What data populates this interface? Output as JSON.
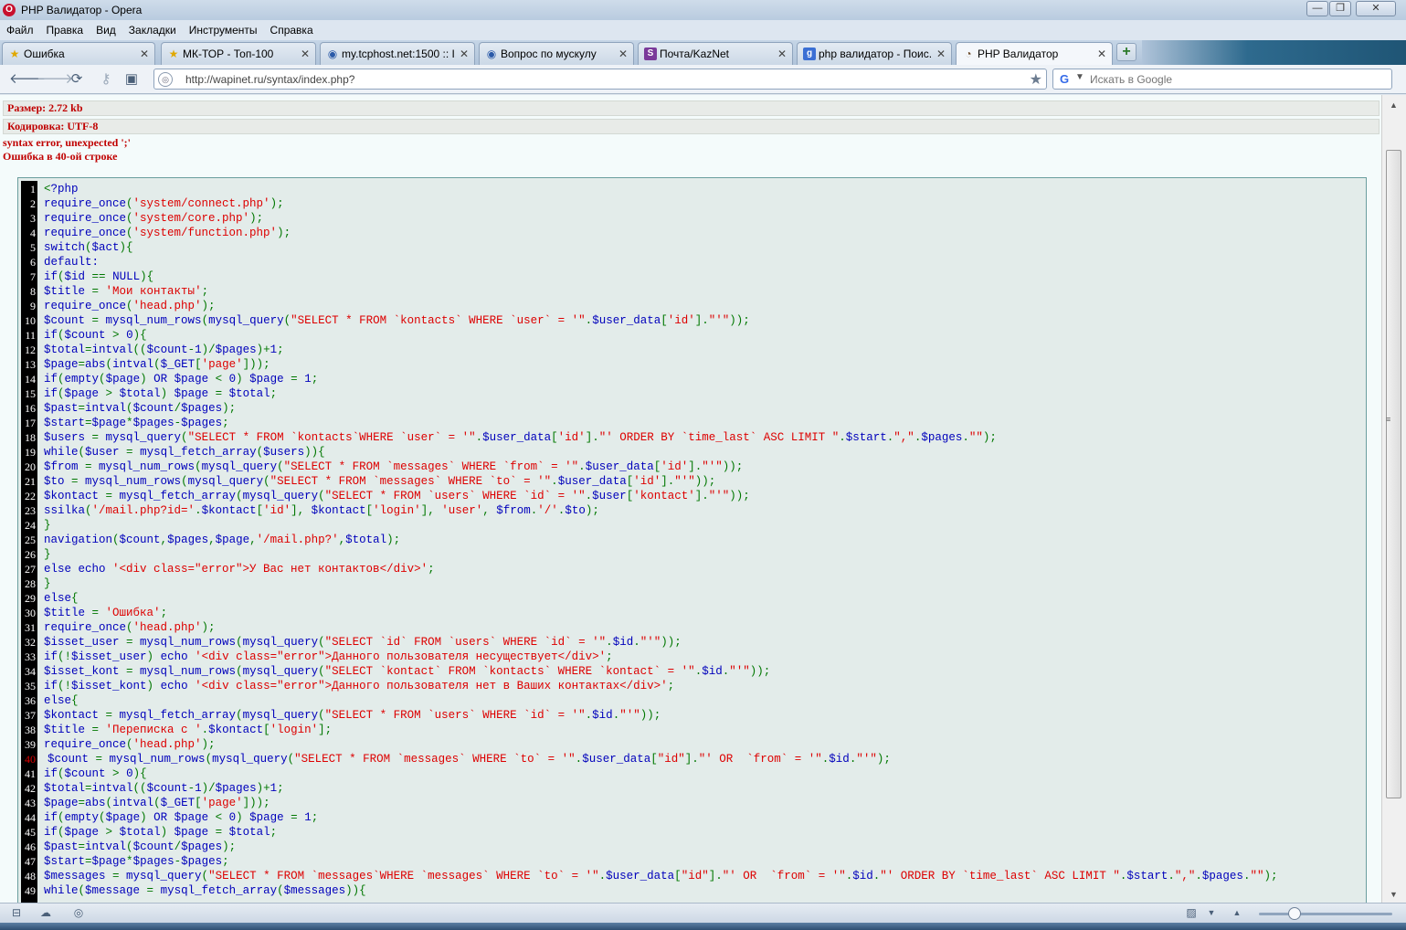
{
  "window": {
    "title": "PHP Валидатор - Opera",
    "logo_letter": "O",
    "controls": {
      "minimize": "—",
      "maximize": "❐",
      "close": "✕"
    }
  },
  "menu": [
    "Файл",
    "Правка",
    "Вид",
    "Закладки",
    "Инструменты",
    "Справка"
  ],
  "tabs": [
    {
      "label": "Ошибка",
      "icon": "star-icon",
      "active": false
    },
    {
      "label": "МК-ТОР - Топ-100",
      "icon": "star-icon",
      "active": false
    },
    {
      "label": "my.tcphost.net:1500 :: I...",
      "icon": "globe-icon",
      "active": false
    },
    {
      "label": "Вопрос по мускулу",
      "icon": "globe-icon",
      "active": false
    },
    {
      "label": "Почта/KazNet",
      "icon": "mail-icon",
      "active": false
    },
    {
      "label": "php валидатор - Поис...",
      "icon": "google-icon",
      "active": false
    },
    {
      "label": "PHP Валидатор",
      "icon": "site-icon",
      "active": true
    }
  ],
  "address": {
    "url": "http://wapinet.ru/syntax/index.php?"
  },
  "search": {
    "placeholder": "Искать в Google"
  },
  "page": {
    "size_label": "Размер: 2.72 kb",
    "encoding_label": "Кодировка: UTF-8",
    "error_message": "syntax error, unexpected ';'",
    "error_line_message": "Ошибка в 40-ой строке",
    "error_line": 40
  },
  "code_lines": [
    {
      "n": "1",
      "code": "<?php"
    },
    {
      "n": "2",
      "code": "require_once('system/connect.php');"
    },
    {
      "n": "3",
      "code": "require_once('system/core.php');"
    },
    {
      "n": "4",
      "code": "require_once('system/function.php');"
    },
    {
      "n": "5",
      "code": "switch($act){"
    },
    {
      "n": "6",
      "code": "default:"
    },
    {
      "n": "7",
      "code": "if($id == NULL){"
    },
    {
      "n": "8",
      "code": "$title = 'Мои контакты';"
    },
    {
      "n": "9",
      "code": "require_once('head.php');"
    },
    {
      "n": "10",
      "code": "$count = mysql_num_rows(mysql_query(\"SELECT * FROM `kontacts` WHERE `user` = '\".$user_data['id'].\"'\"));"
    },
    {
      "n": "11",
      "code": "if($count > 0){"
    },
    {
      "n": "12",
      "code": "$total=intval(($count-1)/$pages)+1;"
    },
    {
      "n": "13",
      "code": "$page=abs(intval($_GET['page']));"
    },
    {
      "n": "14",
      "code": "if(empty($page) OR $page < 0) $page = 1;"
    },
    {
      "n": "15",
      "code": "if($page > $total) $page = $total;"
    },
    {
      "n": "16",
      "code": "$past=intval($count/$pages);"
    },
    {
      "n": "17",
      "code": "$start=$page*$pages-$pages;"
    },
    {
      "n": "18",
      "code": "$users = mysql_query(\"SELECT * FROM `kontacts`WHERE `user` = '\".$user_data['id'].\"' ORDER BY `time_last` ASC LIMIT \".$start.\",\".$pages.\"\");"
    },
    {
      "n": "19",
      "code": "while($user = mysql_fetch_array($users)){"
    },
    {
      "n": "20",
      "code": "$from = mysql_num_rows(mysql_query(\"SELECT * FROM `messages` WHERE `from` = '\".$user_data['id'].\"'\"));"
    },
    {
      "n": "21",
      "code": "$to = mysql_num_rows(mysql_query(\"SELECT * FROM `messages` WHERE `to` = '\".$user_data['id'].\"'\"));"
    },
    {
      "n": "22",
      "code": "$kontact = mysql_fetch_array(mysql_query(\"SELECT * FROM `users` WHERE `id` = '\".$user['kontact'].\"'\"));"
    },
    {
      "n": "23",
      "code": "ssilka('/mail.php?id='.$kontact['id'], $kontact['login'], 'user', $from.'/'.$to);"
    },
    {
      "n": "24",
      "code": "}"
    },
    {
      "n": "25",
      "code": "navigation($count,$pages,$page,'/mail.php?',$total);"
    },
    {
      "n": "26",
      "code": "}"
    },
    {
      "n": "27",
      "code": "else echo '<div class=\"error\">У Вас нет контактов</div>';"
    },
    {
      "n": "28",
      "code": "}"
    },
    {
      "n": "29",
      "code": "else{"
    },
    {
      "n": "30",
      "code": "$title = 'Ошибка';"
    },
    {
      "n": "31",
      "code": "require_once('head.php');"
    },
    {
      "n": "32",
      "code": "$isset_user = mysql_num_rows(mysql_query(\"SELECT `id` FROM `users` WHERE `id` = '\".$id.\"'\"));"
    },
    {
      "n": "33",
      "code": "if(!$isset_user) echo '<div class=\"error\">Данного пользователя несуществует</div>';"
    },
    {
      "n": "34",
      "code": "$isset_kont = mysql_num_rows(mysql_query(\"SELECT `kontact` FROM `kontacts` WHERE `kontact` = '\".$id.\"'\"));"
    },
    {
      "n": "35",
      "code": "if(!$isset_kont) echo '<div class=\"error\">Данного пользователя нет в Ваших контактах</div>';"
    },
    {
      "n": "36",
      "code": "else{"
    },
    {
      "n": "37",
      "code": "$kontact = mysql_fetch_array(mysql_query(\"SELECT * FROM `users` WHERE `id` = '\".$id.\"'\"));"
    },
    {
      "n": "38",
      "code": "$title = 'Переписка с '.$kontact['login'];"
    },
    {
      "n": "39",
      "code": "require_once('head.php');"
    },
    {
      "n": "40",
      "code": "$count = mysql_num_rows(mysql_query(\"SELECT * FROM `messages` WHERE `to` = '\".$user_data[\"id\"].\"' OR  `from` = '\".$id.\"'\");"
    },
    {
      "n": "41",
      "code": "if($count > 0){"
    },
    {
      "n": "42",
      "code": "$total=intval(($count-1)/$pages)+1;"
    },
    {
      "n": "43",
      "code": "$page=abs(intval($_GET['page']));"
    },
    {
      "n": "44",
      "code": "if(empty($page) OR $page < 0) $page = 1;"
    },
    {
      "n": "45",
      "code": "if($page > $total) $page = $total;"
    },
    {
      "n": "46",
      "code": "$past=intval($count/$pages);"
    },
    {
      "n": "47",
      "code": "$start=$page*$pages-$pages;"
    },
    {
      "n": "48",
      "code": "$messages = mysql_query(\"SELECT * FROM `messages`WHERE `messages` WHERE `to` = '\".$user_data[\"id\"].\"' OR  `from` = '\".$id.\"' ORDER BY `time_last` ASC LIMIT \".$start.\",\".$pages.\"\");"
    },
    {
      "n": "49",
      "code": "while($message = mysql_fetch_array($messages)){"
    }
  ],
  "colors": {
    "error_text": "#c00000",
    "code_keyword": "#007700",
    "code_string": "#dd0000",
    "code_default": "#0000bb",
    "code_background": "#e3ecea"
  }
}
